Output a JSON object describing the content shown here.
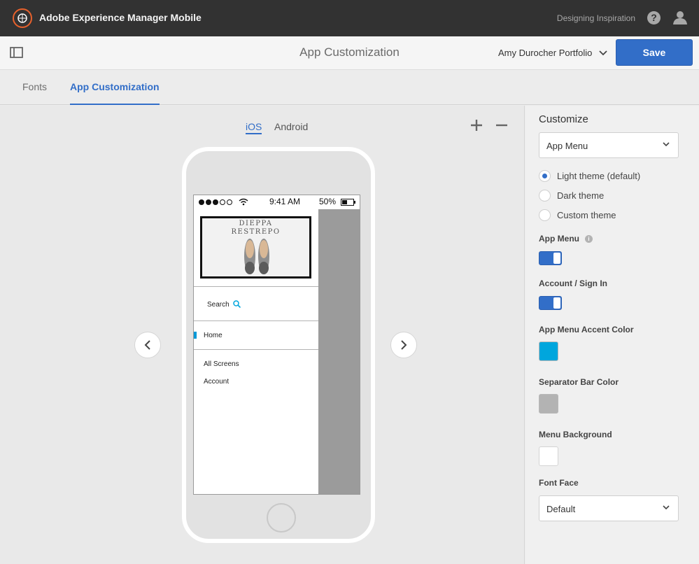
{
  "topbar": {
    "app_title": "Adobe Experience Manager Mobile",
    "org_name": "Designing Inspiration",
    "help_icon": "?",
    "accent_color": "#e8612c"
  },
  "header": {
    "page_title": "App Customization",
    "project_name": "Amy Durocher Portfolio",
    "save_label": "Save"
  },
  "tabs": [
    {
      "label": "Fonts",
      "active": false
    },
    {
      "label": "App Customization",
      "active": true
    }
  ],
  "preview": {
    "os_options": [
      "iOS",
      "Android"
    ],
    "selected_os": "iOS",
    "status_bar": {
      "time": "9:41 AM",
      "battery": "50%"
    },
    "hero_text_line1": "DIEPPA",
    "hero_text_line2": "RESTREPO",
    "search_label": "Search",
    "menu_items": [
      "Home",
      "All Screens",
      "Account"
    ]
  },
  "panel": {
    "title": "Customize",
    "section_select": "App Menu",
    "themes": [
      {
        "label": "Light theme (default)",
        "selected": true
      },
      {
        "label": "Dark theme",
        "selected": false
      },
      {
        "label": "Custom theme",
        "selected": false
      }
    ],
    "app_menu_label": "App Menu",
    "account_label": "Account / Sign In",
    "accent_color_label": "App Menu Accent Color",
    "separator_color_label": "Separator Bar Color",
    "menu_bg_label": "Menu Background",
    "font_face_label": "Font Face",
    "font_face_value": "Default",
    "colors": {
      "accent": "#00a6dd",
      "separator": "#b3b3b3",
      "background": "#ffffff",
      "brand_blue": "#326ec8"
    }
  }
}
